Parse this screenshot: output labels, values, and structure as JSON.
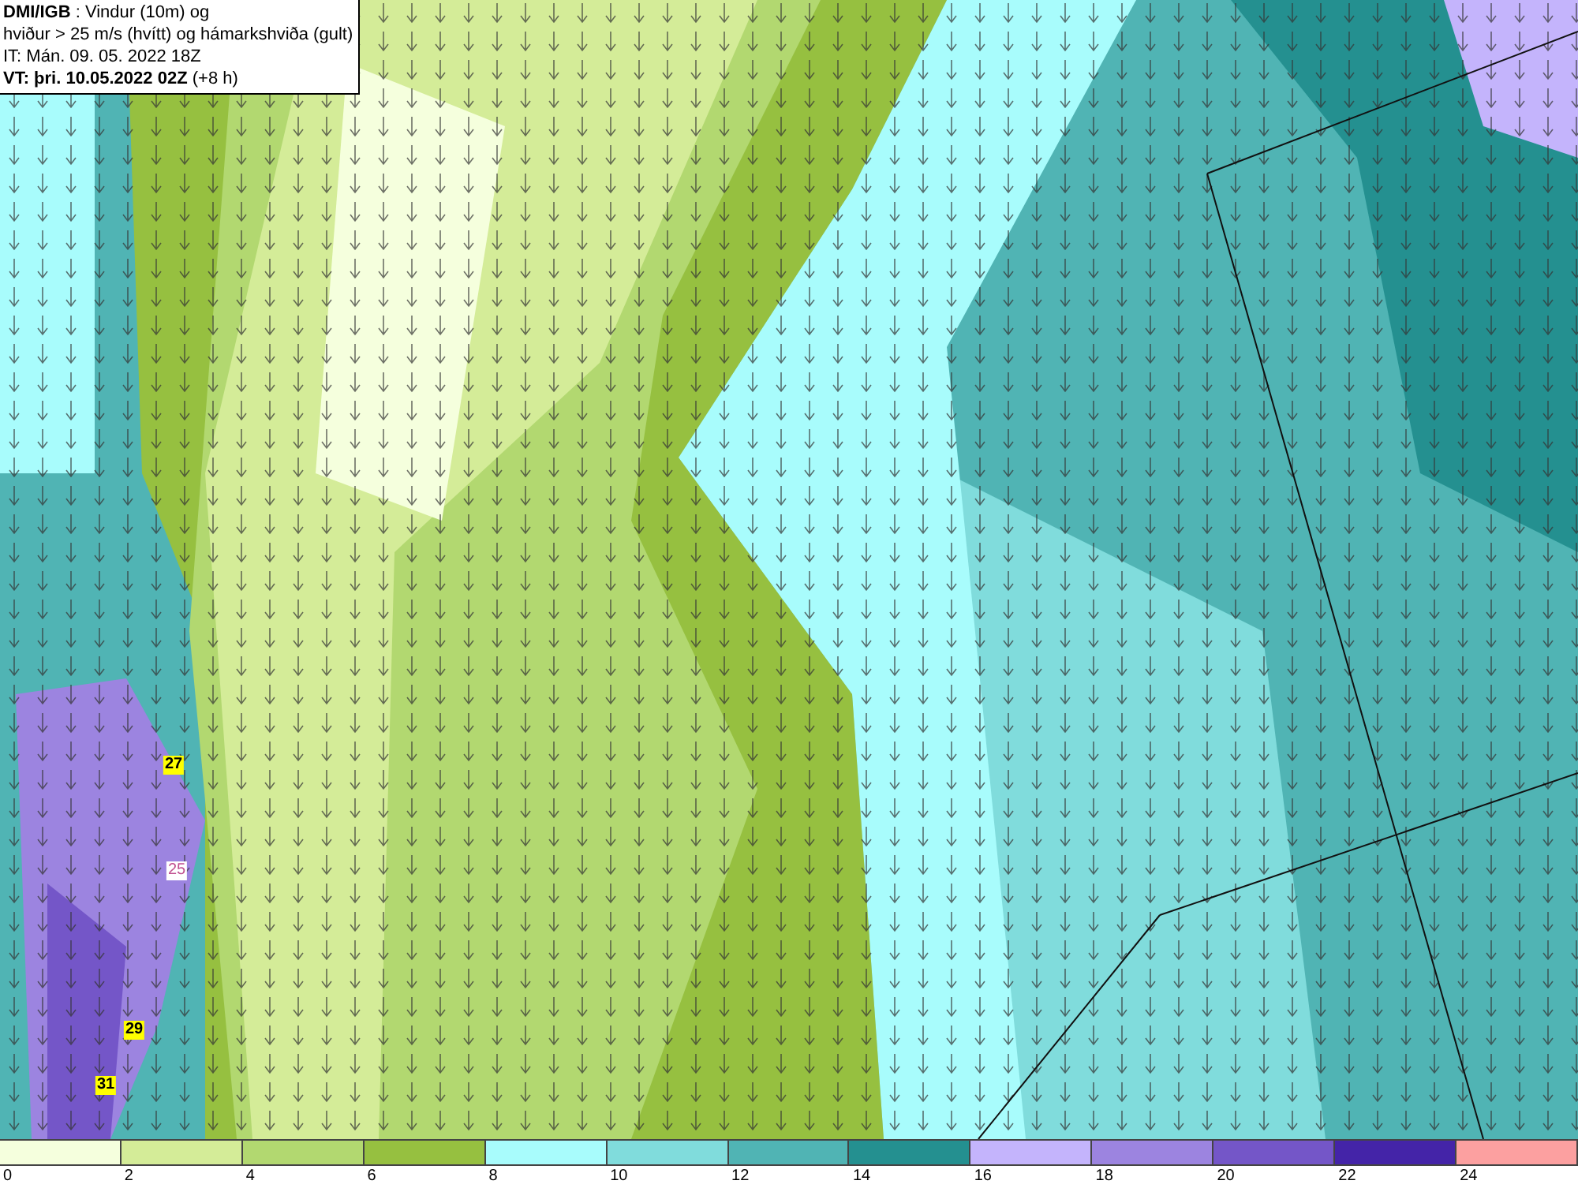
{
  "header": {
    "lines": [
      "**DMI/IGB** : Vindur (10m) og",
      "hviður > 25 m/s (hvítt) og hámarkshviða (gult)",
      "IT: Mán. 09. 05. 2022 18Z",
      "**VT: þri. 10.05.2022 02Z** (+8 h)"
    ]
  },
  "map": {
    "labels": [
      {
        "text": "27",
        "kind": "max_gust"
      },
      {
        "text": "25",
        "kind": "gust_contour"
      },
      {
        "text": "29",
        "kind": "max_gust"
      },
      {
        "text": "31",
        "kind": "max_gust"
      }
    ]
  },
  "legend": {
    "bins": [
      {
        "color": "#f5ffdd"
      },
      {
        "color": "#d4ec98"
      },
      {
        "color": "#b2d870"
      },
      {
        "color": "#96c040"
      },
      {
        "color": "#a8fcfc"
      },
      {
        "color": "#80dcdc"
      },
      {
        "color": "#50b4b4"
      },
      {
        "color": "#249090"
      },
      {
        "color": "#c4b4fc"
      },
      {
        "color": "#9c84e0"
      },
      {
        "color": "#7456c8"
      },
      {
        "color": "#4424a8"
      },
      {
        "color": "#fca0a0"
      }
    ],
    "ticks": [
      "0",
      "2",
      "4",
      "6",
      "8",
      "10",
      "12",
      "14",
      "16",
      "18",
      "20",
      "22",
      "24"
    ]
  }
}
